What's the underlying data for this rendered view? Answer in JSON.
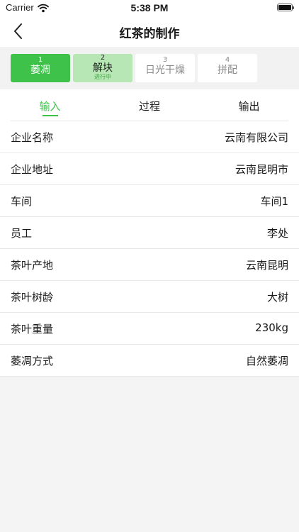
{
  "status_bar": {
    "carrier": "Carrier",
    "time": "5:38 PM"
  },
  "nav": {
    "title": "红茶的制作",
    "back_icon": "chevron-left-icon"
  },
  "steps": [
    {
      "number": "1",
      "name": "萎凋",
      "state": "done"
    },
    {
      "number": "2",
      "name": "解块",
      "status": "进行中",
      "state": "current"
    },
    {
      "number": "3",
      "name": "日光干燥",
      "state": "pending"
    },
    {
      "number": "4",
      "name": "拼配",
      "state": "pending"
    }
  ],
  "tabs": [
    {
      "label": "输入",
      "active": true
    },
    {
      "label": "过程",
      "active": false
    },
    {
      "label": "输出",
      "active": false
    }
  ],
  "rows": [
    {
      "label": "企业名称",
      "value": "云南有限公司"
    },
    {
      "label": "企业地址",
      "value": "云南昆明市"
    },
    {
      "label": "车间",
      "value": "车间1"
    },
    {
      "label": "员工",
      "value": "李处"
    },
    {
      "label": "茶叶产地",
      "value": "云南昆明"
    },
    {
      "label": "茶叶树龄",
      "value": "大树"
    },
    {
      "label": "茶叶重量",
      "value": "230kg"
    },
    {
      "label": "萎凋方式",
      "value": "自然萎凋"
    }
  ],
  "colors": {
    "accent": "#3ec24a",
    "current_step": "#b7e7b4",
    "background": "#f4f4f4"
  }
}
